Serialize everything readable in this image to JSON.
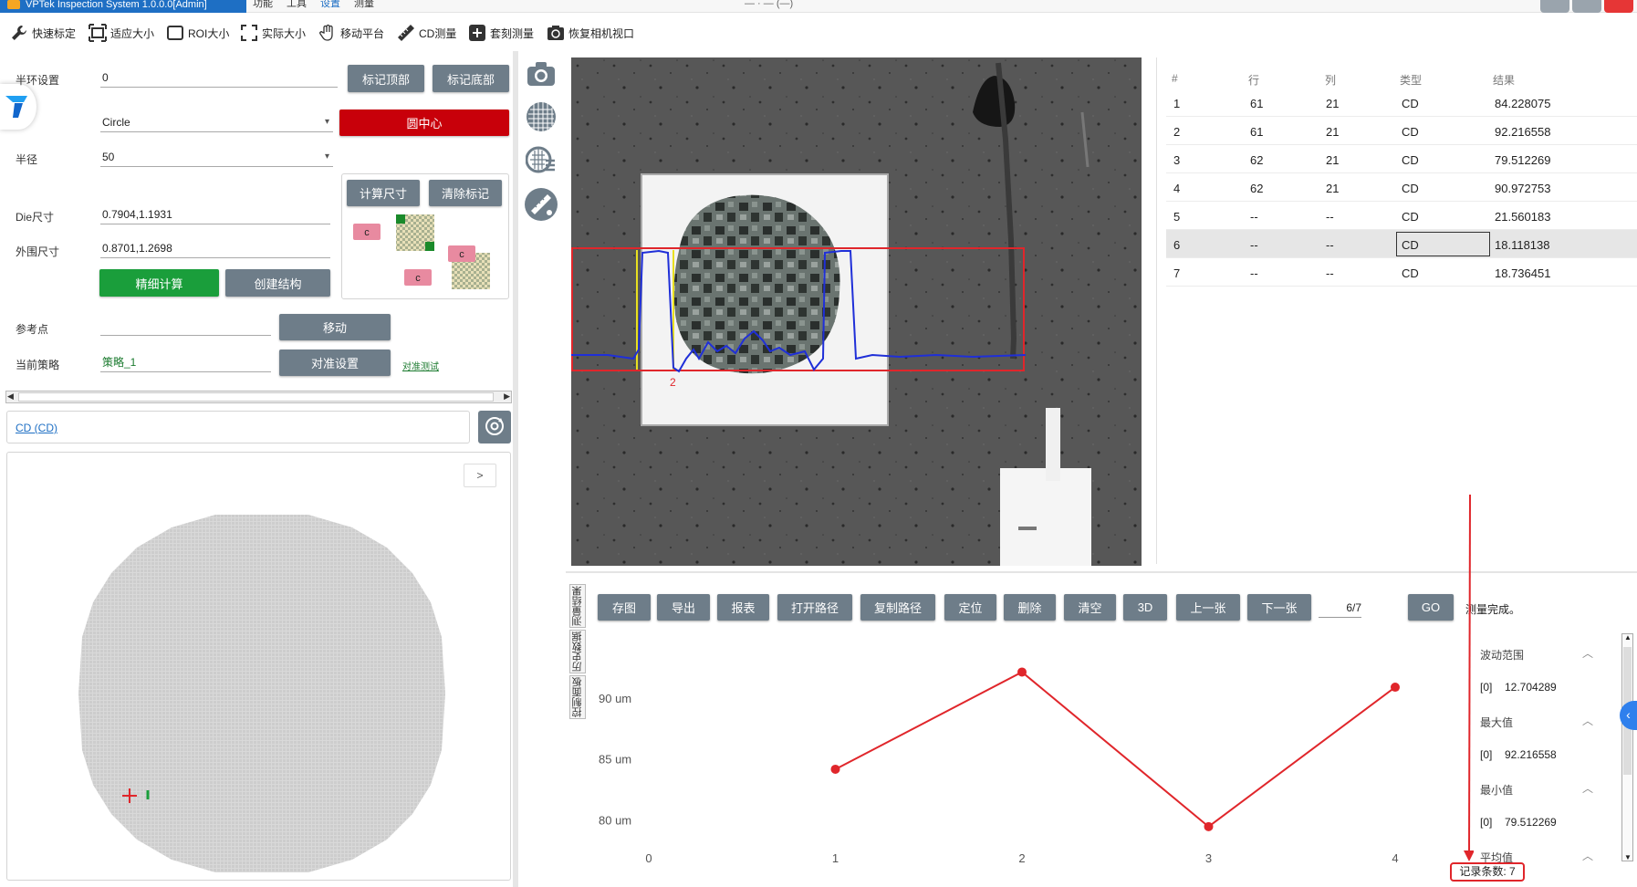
{
  "titlebar": {
    "app_title": "VPTek Inspection System 1.0.0.0[Admin]",
    "menus": [
      "功能",
      "工具",
      "设置",
      "测量"
    ],
    "window_title_partial": "— · — (—)"
  },
  "toolbar": [
    {
      "icon": "wrench-icon",
      "label": "快速标定"
    },
    {
      "icon": "fit-size-icon",
      "label": "适应大小"
    },
    {
      "icon": "roi-rect-icon",
      "label": "ROI大小"
    },
    {
      "icon": "expand-icon",
      "label": "实际大小"
    },
    {
      "icon": "hand-move-icon",
      "label": "移动平台"
    },
    {
      "icon": "ruler-icon",
      "label": "CD测量"
    },
    {
      "icon": "plus-box-icon",
      "label": "套刻测量"
    },
    {
      "icon": "camera-reset-icon",
      "label": "恢复相机视口"
    }
  ],
  "left": {
    "ring_label": "半环设置",
    "ring_value": "0",
    "mark_top_btn": "标记顶部",
    "mark_bottom_btn": "标记底部",
    "shape_value": "Circle",
    "circle_center_btn": "圆中心",
    "radius_label": "半径",
    "radius_value": "50",
    "calc_size_btn": "计算尺寸",
    "clear_mark_btn": "清除标记",
    "die_label": "Die尺寸",
    "die_value": "0.7904,1.1931",
    "outer_label": "外围尺寸",
    "outer_value": "0.8701,1.2698",
    "fine_calc_btn": "精细计算",
    "create_struct_btn": "创建结构",
    "ref_label": "参考点",
    "ref_value": "",
    "move_btn": "移动",
    "strategy_label": "当前策略",
    "strategy_value": "策略_1",
    "align_btn": "对准设置",
    "align_test_link": "对准测试",
    "cd_link": "CD (CD)",
    "expand_arrow": ">",
    "diagram_c": "c"
  },
  "table": {
    "headers": [
      "#",
      "行",
      "列",
      "类型",
      "结果"
    ],
    "rows": [
      [
        "1",
        "61",
        "21",
        "CD",
        "84.228075"
      ],
      [
        "2",
        "61",
        "21",
        "CD",
        "92.216558"
      ],
      [
        "3",
        "62",
        "21",
        "CD",
        "79.512269"
      ],
      [
        "4",
        "62",
        "21",
        "CD",
        "90.972753"
      ],
      [
        "5",
        "--",
        "--",
        "CD",
        "21.560183"
      ],
      [
        "6",
        "--",
        "--",
        "CD",
        "18.118138"
      ],
      [
        "7",
        "--",
        "--",
        "CD",
        "18.736451"
      ]
    ],
    "selected_row": 5
  },
  "bottom": {
    "buttons": [
      "存图",
      "导出",
      "报表",
      "打开路径",
      "复制路径",
      "定位",
      "删除",
      "清空",
      "3D",
      "上一张",
      "下一张"
    ],
    "page_value": "6/7",
    "go_btn": "GO",
    "status": "测量完成。",
    "tabs": [
      "测量结果",
      "历史数据",
      "控制面板"
    ],
    "record_count": "记录条数: 7"
  },
  "stats": [
    {
      "title": "波动范围",
      "index": "[0]",
      "value": "12.704289"
    },
    {
      "title": "最大值",
      "index": "[0]",
      "value": "92.216558"
    },
    {
      "title": "最小值",
      "index": "[0]",
      "value": "79.512269"
    },
    {
      "title": "平均值",
      "index": "",
      "value": ""
    }
  ],
  "overlay": {
    "label_2": "2"
  },
  "chart_data": {
    "type": "line",
    "x": [
      1,
      2,
      3,
      4
    ],
    "values": [
      84.228075,
      92.216558,
      79.512269,
      90.972753
    ],
    "xticks": [
      "0",
      "1",
      "2",
      "3",
      "4"
    ],
    "yticks": [
      "80 um",
      "85 um",
      "90 um"
    ],
    "xlim": [
      0,
      4
    ],
    "ylim": [
      78,
      93
    ],
    "color": "#e0262b",
    "grid": false
  },
  "colors": {
    "accent_blue": "#1e6fc4",
    "button_gray": "#6e7d89",
    "button_red": "#c8000a",
    "button_green": "#1a9e3b",
    "record_border": "#e0262b"
  }
}
